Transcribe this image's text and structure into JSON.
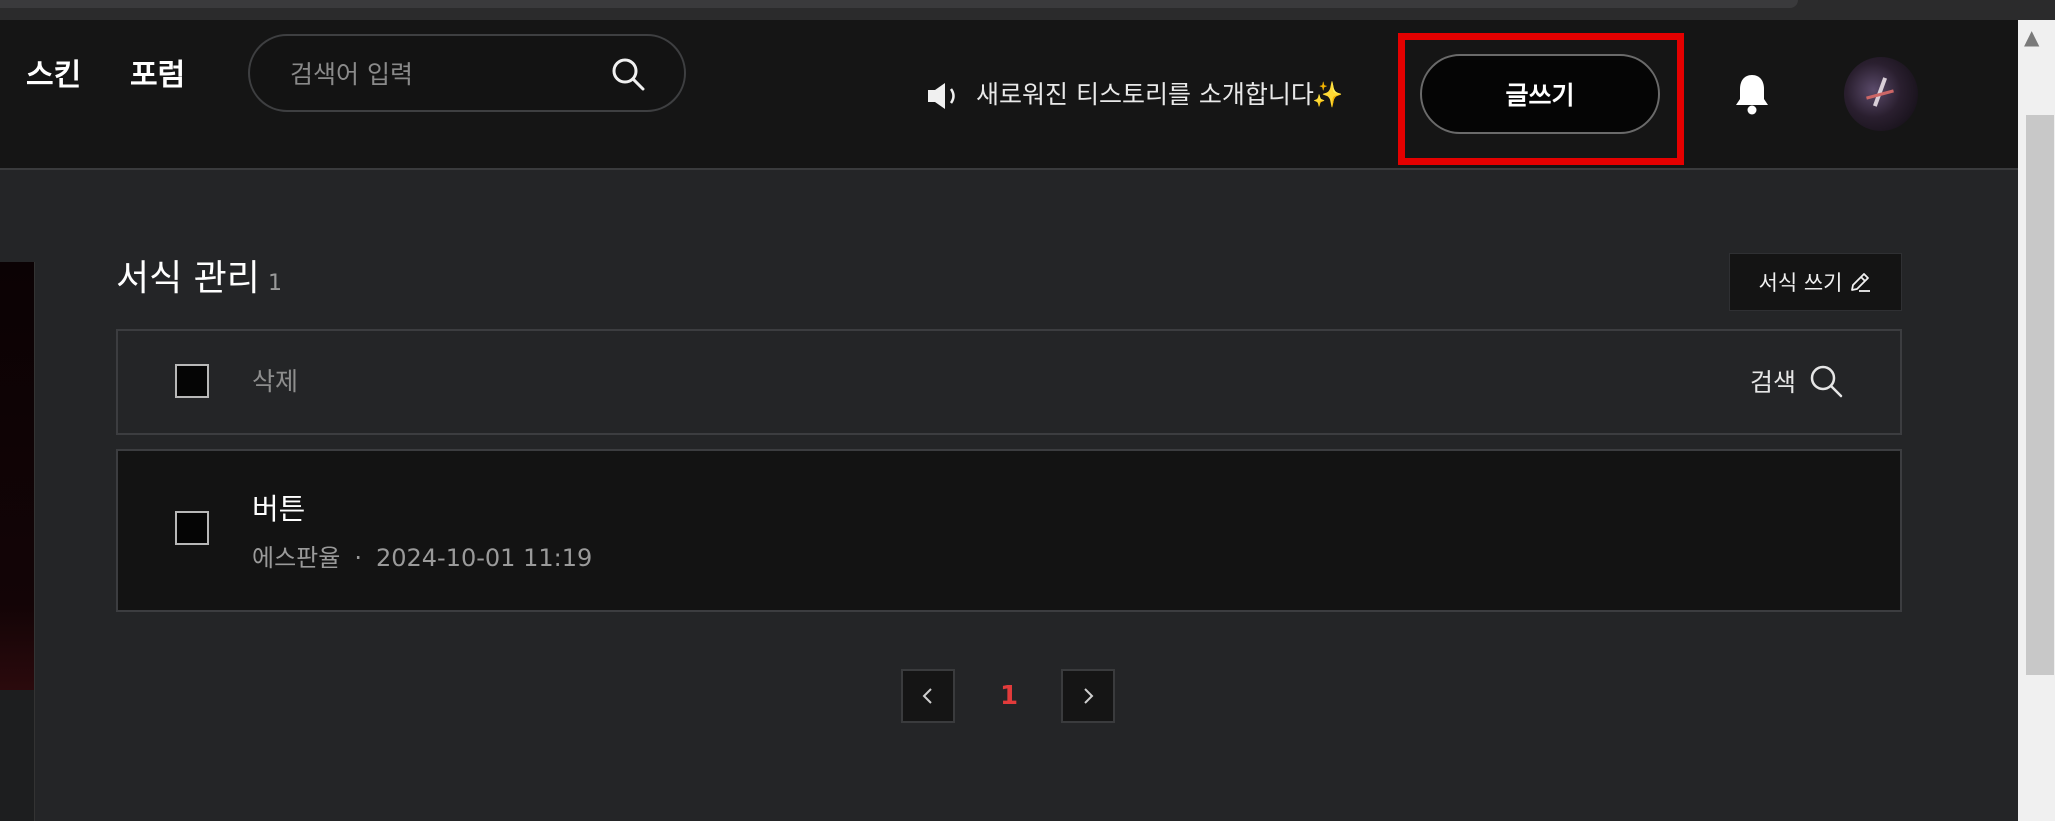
{
  "header": {
    "nav": [
      "스킨",
      "포럼"
    ],
    "search": {
      "placeholder": "검색어 입력"
    },
    "notice": {
      "text": "새로워진 티스토리를 소개합니다",
      "sparkle": "✨"
    },
    "write_button": "글쓰기",
    "icons": {
      "search": "search-icon",
      "speaker": "speaker-icon",
      "bell": "bell-icon",
      "avatar": "avatar"
    }
  },
  "highlight": {
    "color": "#e40000",
    "target": "write-button"
  },
  "main": {
    "title": "서식 관리",
    "count": "1",
    "write_format_button": "서식 쓰기",
    "toolbar": {
      "delete_label": "삭제",
      "search_label": "검색"
    },
    "items": [
      {
        "name": "버튼",
        "author": "에스판율",
        "date": "2024-10-01 11:19"
      }
    ],
    "pagination": {
      "current": "1"
    }
  },
  "colors": {
    "background": "#242527",
    "header": "#151515",
    "accent_page": "#e23b3b"
  }
}
